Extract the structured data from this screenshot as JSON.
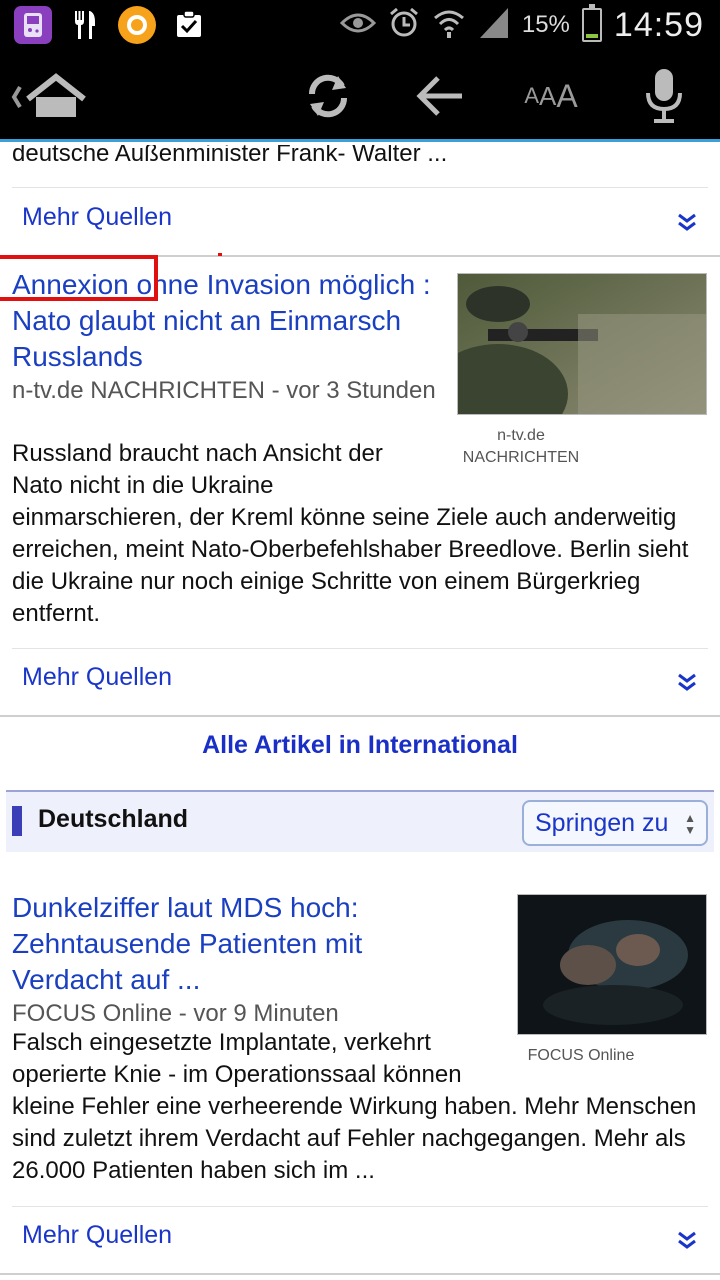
{
  "status_bar": {
    "battery_percent": "15%",
    "battery_level": 0.15,
    "time": "14:59",
    "notification_icons": [
      "game-icon",
      "restaurant-icon",
      "orange-app-icon",
      "clipboard-check-icon"
    ],
    "system_icons": [
      "eye-icon",
      "alarm-icon",
      "wifi-icon",
      "signal-icon"
    ]
  },
  "toolbar": {
    "home_icon": "home-icon",
    "refresh_icon": "refresh-icon",
    "back_icon": "back-arrow-icon",
    "font_size": {
      "small": "A",
      "medium": "A",
      "large": "A"
    },
    "mic_icon": "microphone-icon"
  },
  "prev_article": {
    "snippet_tail": "deutsche Außenminister Frank- Walter ...",
    "more_sources": "Mehr Quellen"
  },
  "article1": {
    "title": "Annexion ohne Invasion möglich : Nato glaubt nicht an Einmarsch Russlands",
    "source_line": "n-tv.de NACHRICHTEN - vor 3 Stunden",
    "image_caption": "n-tv.de NACHRICHTEN",
    "snippet": "Russland braucht nach Ansicht der Nato nicht in die Ukraine einmarschieren, der Kreml könne seine Ziele auch anderweitig erreichen, meint Nato-Oberbefehlshaber Breedlove. Berlin sieht die Ukraine nur noch einige Schritte von einem Bürgerkrieg entfernt.",
    "more_sources": "Mehr Quellen"
  },
  "all_articles_link": "Alle Artikel in International",
  "section": {
    "title": "Deutschland",
    "jump_select": "Springen zu"
  },
  "article2": {
    "title": "Dunkelziffer laut MDS hoch: Zehntausende Patienten mit Verdacht auf ...",
    "source_line": "FOCUS Online - vor 9 Minuten",
    "image_caption": "FOCUS Online",
    "snippet": "Falsch eingesetzte Implantate, verkehrt operierte Knie - im Operationssaal können kleine Fehler eine verheerende Wirkung haben. Mehr Menschen sind zuletzt ihrem Verdacht auf Fehler nachgegangen. Mehr als 26.000 Patienten haben sich im ...",
    "more_sources": "Mehr Quellen"
  },
  "colors": {
    "link_blue": "#1a3fc0",
    "accent_blue": "#3aa0d8",
    "highlight_red": "#e01010"
  }
}
